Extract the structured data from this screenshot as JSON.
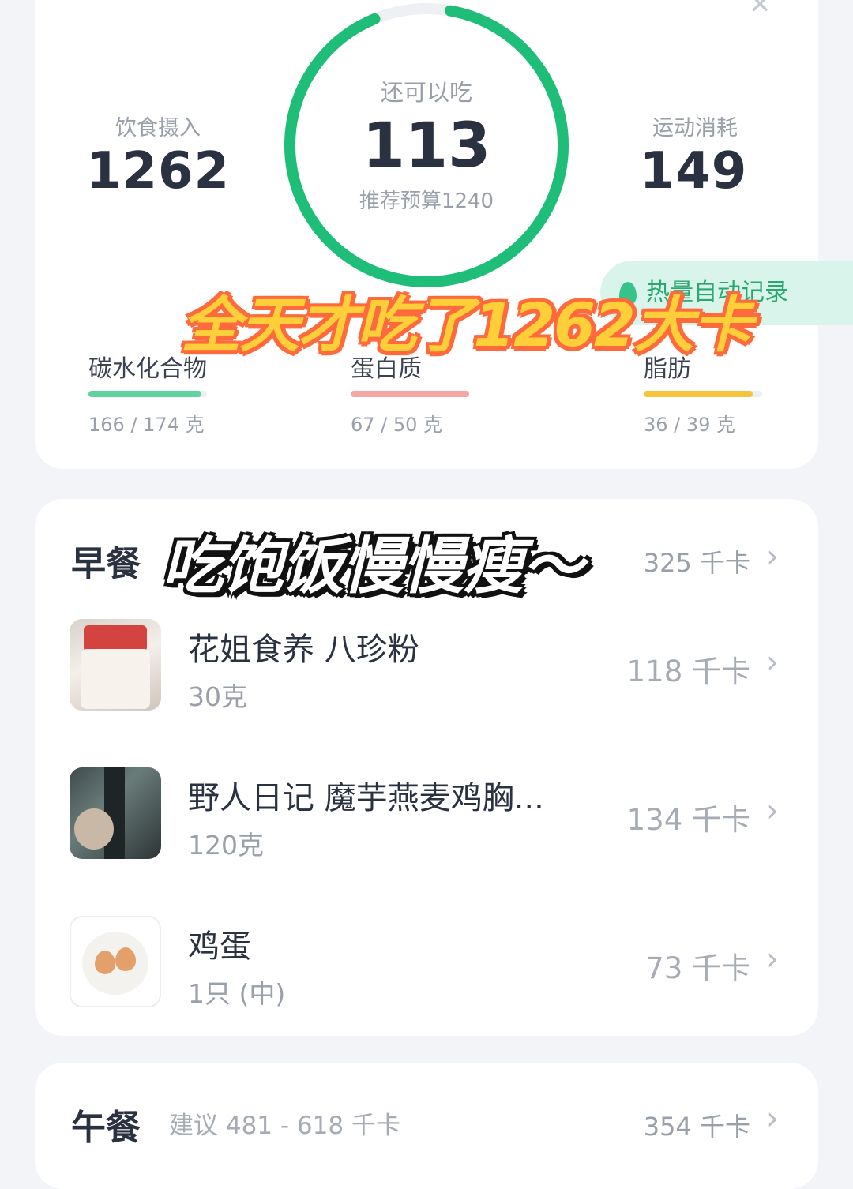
{
  "summary": {
    "intake_label": "饮食摄入",
    "intake_value": "1262",
    "remaining_label": "还可以吃",
    "remaining_value": "113",
    "budget_text": "推荐预算1240",
    "exercise_label": "运动消耗",
    "exercise_value": "149",
    "auto_record_label": "热量自动记录",
    "ring_progress": 0.91,
    "ring_color": "#1fbe78"
  },
  "macros": [
    {
      "label": "碳水化合物",
      "amount": "166 / 174 克",
      "progress": 0.95,
      "color": "#5fd3a0"
    },
    {
      "label": "蛋白质",
      "amount": "67 / 50 克",
      "progress": 1.0,
      "color": "#f6a7a3"
    },
    {
      "label": "脂肪",
      "amount": "36 / 39 克",
      "progress": 0.92,
      "color": "#f7c43c"
    }
  ],
  "overlay": {
    "headline": "全天才吃了1262大卡",
    "caption": "吃饱饭慢慢瘦～"
  },
  "breakfast": {
    "title": "早餐",
    "total": "325 千卡",
    "items": [
      {
        "name": "花姐食养 八珍粉",
        "amount": "30克",
        "kcal": "118 千卡"
      },
      {
        "name": "野人日记 魔芋燕麦鸡胸...",
        "amount": "120克",
        "kcal": "134 千卡"
      },
      {
        "name": "鸡蛋",
        "amount": "1只 (中)",
        "kcal": "73 千卡"
      }
    ]
  },
  "lunch": {
    "title": "午餐",
    "hint": "建议 481 - 618 千卡",
    "total": "354 千卡"
  },
  "icons": {
    "close": "close-icon",
    "chevron": "chevron-right-icon",
    "flame": "flame-icon"
  }
}
